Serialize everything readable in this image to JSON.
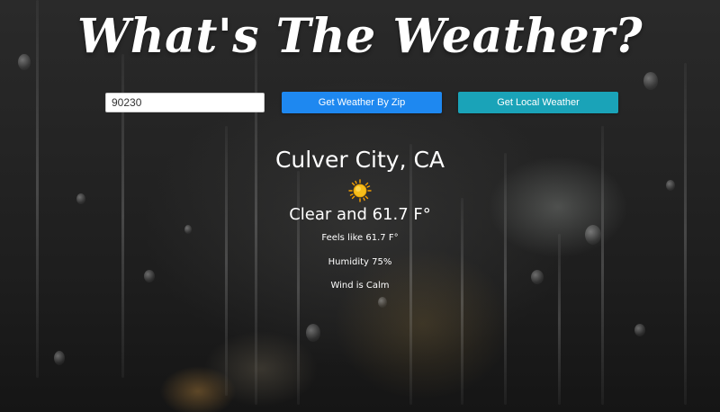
{
  "page": {
    "title": "What's The Weather?"
  },
  "search": {
    "zip_value": "90230",
    "zip_button_label": "Get Weather By Zip",
    "local_button_label": "Get Local Weather"
  },
  "weather": {
    "location": "Culver City, CA",
    "icon": "sun-icon",
    "condition_line": "Clear and 61.7 F°",
    "feels_like": "Feels like 61.7 F°",
    "humidity": "Humidity 75%",
    "wind": "Wind is Calm"
  },
  "colors": {
    "zip_button": "#1e88f0",
    "local_button": "#1aa3b8",
    "text": "#ffffff",
    "sun": "#f5b800"
  }
}
